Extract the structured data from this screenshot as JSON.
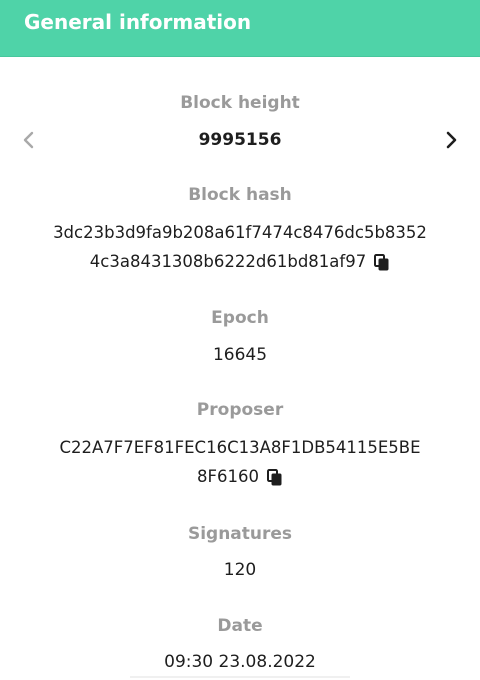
{
  "header": {
    "title": "General information",
    "color": "#4fd3a8"
  },
  "block_height": {
    "label": "Block height",
    "value": "9995156",
    "prev_icon": "chevron-left-icon",
    "next_icon": "chevron-right-icon"
  },
  "block_hash": {
    "label": "Block hash",
    "line1": "3dc23b3d9fa9b208a61f7474c8476dc5b8352",
    "line2": "4c3a8431308b6222d61bd81af97",
    "copy_icon": "copy-icon"
  },
  "epoch": {
    "label": "Epoch",
    "value": "16645"
  },
  "proposer": {
    "label": "Proposer",
    "line1": "C22A7F7EF81FEC16C13A8F1DB54115E5BE",
    "line2": "8F6160",
    "copy_icon": "copy-icon"
  },
  "signatures": {
    "label": "Signatures",
    "value": "120"
  },
  "date": {
    "label": "Date",
    "value": "09:30 23.08.2022"
  }
}
